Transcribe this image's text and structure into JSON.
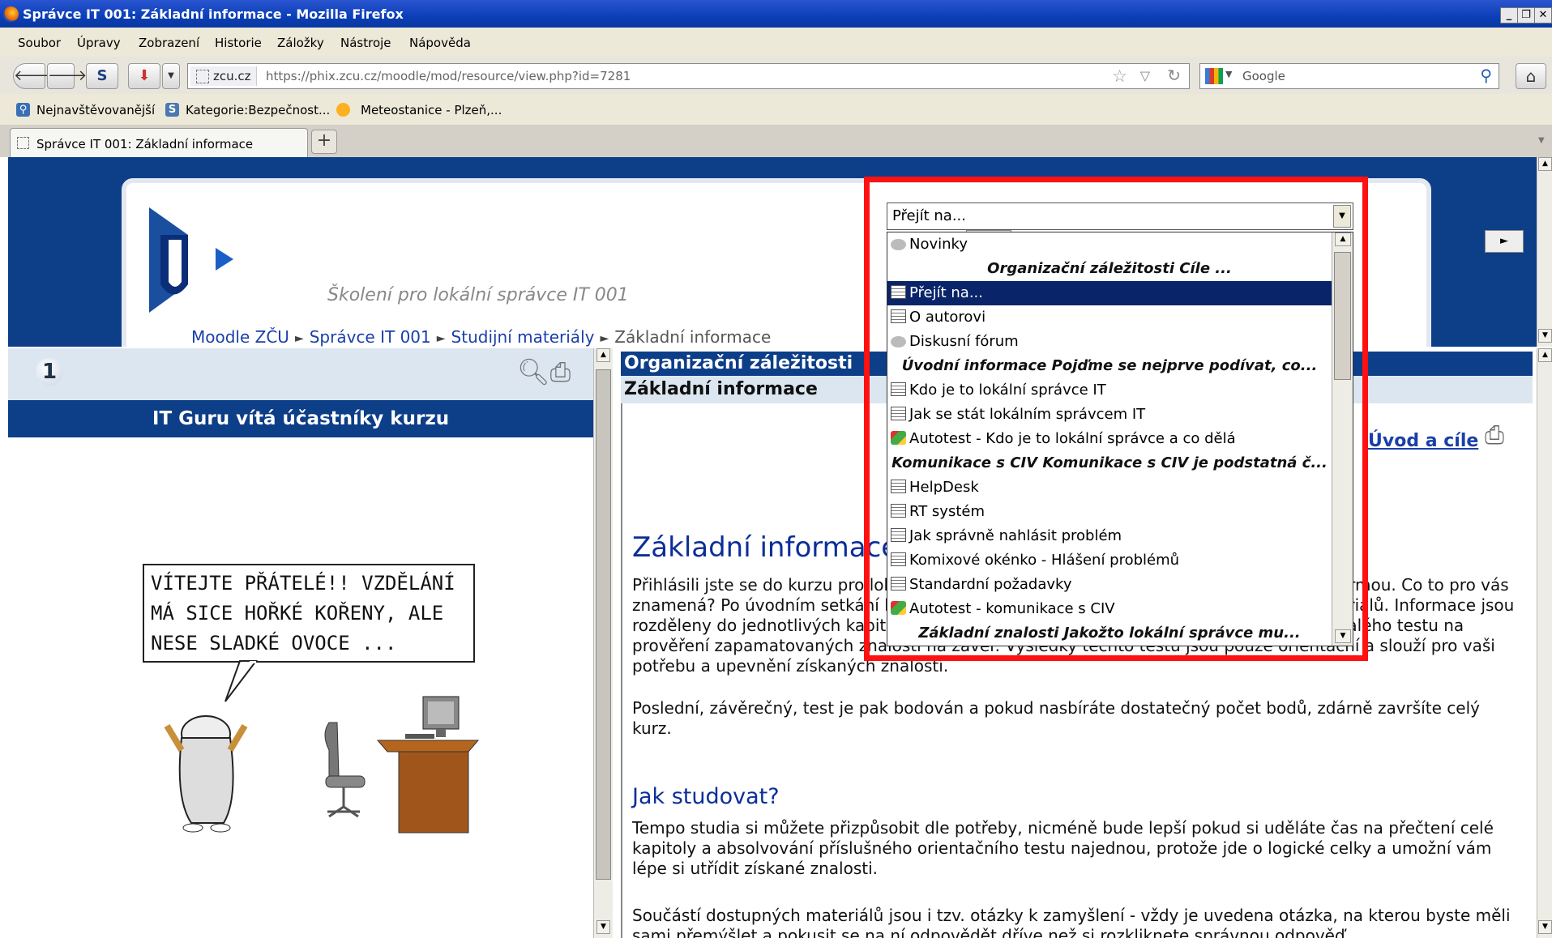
{
  "window": {
    "title": "Správce IT 001: Základní informace - Mozilla Firefox",
    "buttons": [
      "_",
      "❐",
      "✕"
    ]
  },
  "menu": [
    "Soubor",
    "Úpravy",
    "Zobrazení",
    "Historie",
    "Záložky",
    "Nástroje",
    "Nápověda"
  ],
  "navbar": {
    "site_badge": "zcu.cz",
    "url": "https://phix.zcu.cz/moodle/mod/resource/view.php?id=7281",
    "search_engine": "Google",
    "search_placeholder": "Google"
  },
  "bookmarks": [
    "Nejnavštěvovanější",
    "Kategorie:Bezpečnost...",
    "Meteostanice - Plzeň,..."
  ],
  "tabs": [
    {
      "label": "Správce IT 001: Základní informace"
    }
  ],
  "banner": {
    "course_title": "Školení pro lokální správce IT 001",
    "breadcrumb": [
      "Moodle ZČU",
      "Správce IT 001",
      "Studijní materiály",
      "Základní informace"
    ],
    "prev_label": "◄",
    "next_label": "►"
  },
  "jump": {
    "selected": "Přejít na...",
    "options": [
      {
        "kind": "forum",
        "label": "Novinky"
      },
      {
        "kind": "group",
        "label": "Organizační záležitosti Cíle ..."
      },
      {
        "kind": "page",
        "label": "Přejít na...",
        "selected": true
      },
      {
        "kind": "page",
        "label": "O autorovi"
      },
      {
        "kind": "forum",
        "label": "Diskusní fórum"
      },
      {
        "kind": "group",
        "label": "Úvodní informace Pojďme se nejprve podívat, co..."
      },
      {
        "kind": "page",
        "label": "Kdo je to lokální správce IT"
      },
      {
        "kind": "page",
        "label": "Jak se stát lokálním správcem IT"
      },
      {
        "kind": "quiz",
        "label": "Autotest - Kdo je to lokální správce a co dělá"
      },
      {
        "kind": "group",
        "label": "Komunikace s CIV Komunikace s CIV je podstatná č..."
      },
      {
        "kind": "page",
        "label": "HelpDesk"
      },
      {
        "kind": "page",
        "label": "RT systém"
      },
      {
        "kind": "page",
        "label": "Jak správně nahlásit problém"
      },
      {
        "kind": "page",
        "label": "Komixové okénko - Hlášení problémů"
      },
      {
        "kind": "page",
        "label": "Standardní požadavky"
      },
      {
        "kind": "quiz",
        "label": "Autotest - komunikace s CIV"
      },
      {
        "kind": "group",
        "label": "Základní znalosti Jakožto lokální správce mu..."
      }
    ]
  },
  "left": {
    "number": "1",
    "welcome": "IT Guru vítá účastníky kurzu",
    "comic_text": "VÍTEJTE PŘÁTELÉ!! VZDĚLÁNÍ MÁ SICE HOŘKÉ KOŘENY, ALE NESE SLADKÉ OVOCE ..."
  },
  "right": {
    "section": "Organizační záležitosti",
    "page": "Základní informace",
    "uvod_link": "Úvod a cíle",
    "h_basic": "Základní informace",
    "p1": "Přihlásili jste se do kurzu pro lokální správce IT, který probíhá distanční, elektronickou formou. Co to pro vás znamená? Po úvodním setkání budete postupovat samostatně podle připravených materiálů. Informace jsou rozděleny do jednotlivých kapitol. Každá kapitola obsahuje několika studijních textů a malého testu na prověření zapamatovaných znalostí na závěr. Výsledky těchto testů jsou pouze orientační a slouží pro vaši potřebu a upevnění získaných znalostí.",
    "p2": "Poslední, závěrečný, test je pak bodován a pokud nasbíráte dostatečný počet bodů, zdárně završíte celý kurz.",
    "h_study": "Jak studovat?",
    "p3": "Tempo studia si můžete přizpůsobit dle potřeby, nicméně bude lepší pokud si uděláte čas na přečtení celé kapitoly a absolvování příslušného orientačního testu najednou, protože jde o logické celky a umožní vám lépe si utřídit získané znalosti.",
    "p4": "Součástí dostupných materiálů jsou i tzv. otázky k zamyšlení - vždy je uvedena otázka, na kterou byste měli sami přemýšlet a pokusit se na ní odpovědět dříve než si rozkliknete správnou odpověď."
  },
  "colors": {
    "frame_blue": "#0d3e88",
    "highlight": "#ff1111",
    "link": "#1a3fa8",
    "heading": "#0b2e98"
  }
}
